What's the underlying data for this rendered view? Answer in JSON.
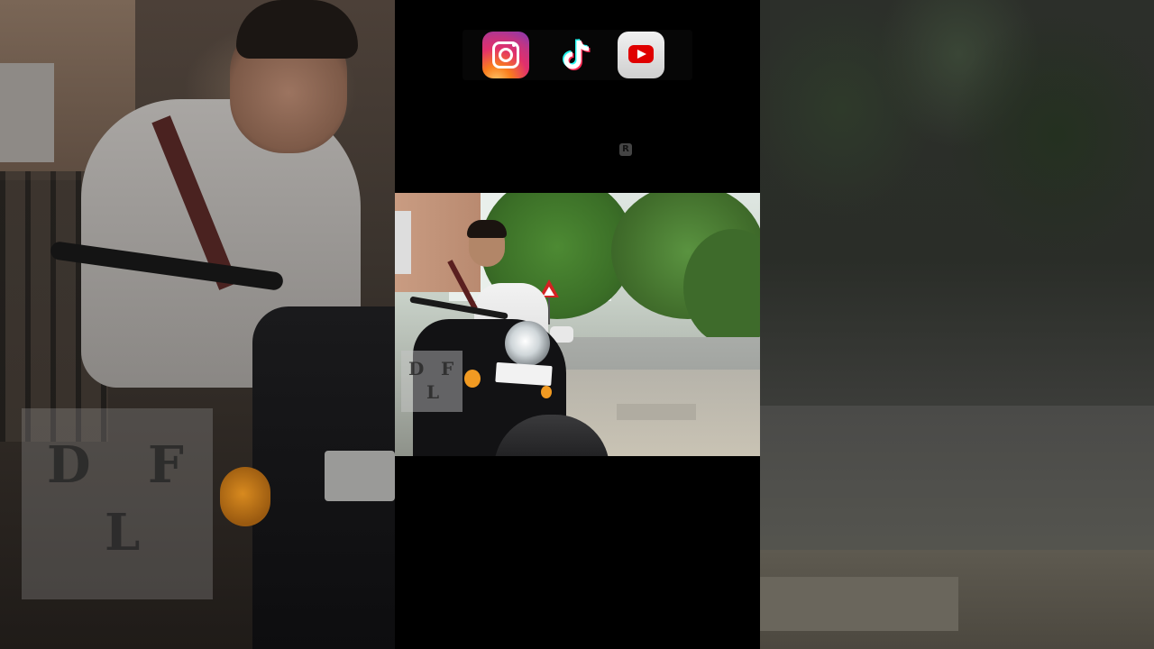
{
  "social_icons": [
    {
      "name": "instagram",
      "icon": "instagram-icon"
    },
    {
      "name": "tiktok",
      "icon": "tiktok-icon"
    },
    {
      "name": "youtube",
      "icon": "youtube-icon"
    }
  ],
  "badge": {
    "label": "R"
  },
  "watermark": {
    "top": "D",
    "mid": "F",
    "bottom": "L"
  },
  "colors": {
    "instagram_start": "#fdc468",
    "instagram_end": "#833ab4",
    "youtube_red": "#e00000",
    "tiktok_cyan": "#25f4ee",
    "tiktok_pink": "#fe2c55"
  }
}
